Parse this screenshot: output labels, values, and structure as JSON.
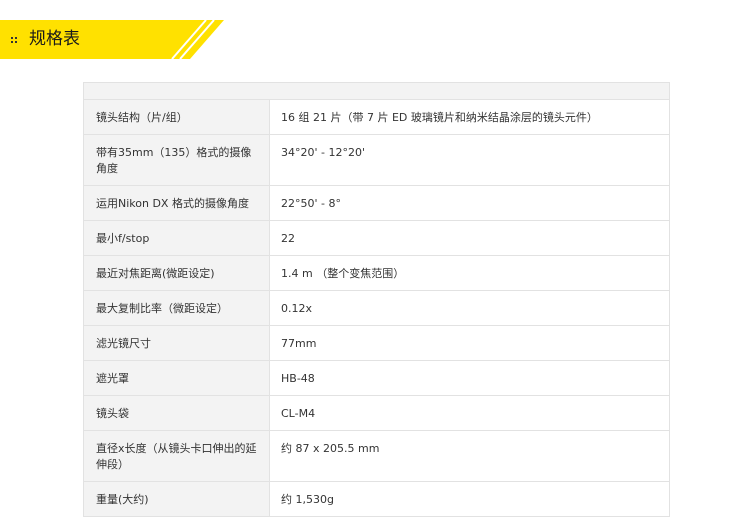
{
  "header": {
    "title": "规格表",
    "accent_color": "#ffe100"
  },
  "specs": [
    {
      "label": "镜头结构（片/组）",
      "value": "16 组 21 片（带 7 片 ED 玻璃镜片和纳米结晶涂层的镜头元件）"
    },
    {
      "label": "带有35mm（135）格式的摄像角度",
      "value": "34°20' - 12°20'"
    },
    {
      "label": "运用Nikon DX 格式的摄像角度",
      "value": "22°50' - 8°"
    },
    {
      "label": "最小f/stop",
      "value": "22"
    },
    {
      "label": "最近对焦距离(微距设定)",
      "value": "1.4 m （整个变焦范围）"
    },
    {
      "label": "最大复制比率（微距设定）",
      "value": "0.12x"
    },
    {
      "label": "滤光镜尺寸",
      "value": "77mm"
    },
    {
      "label": "遮光罩",
      "value": "HB-48"
    },
    {
      "label": "镜头袋",
      "value": "CL-M4"
    },
    {
      "label": "直径x长度（从镜头卡口伸出的延伸段）",
      "value": "约 87 x 205.5 mm"
    },
    {
      "label": "重量(大约)",
      "value": "约 1,530g"
    }
  ]
}
